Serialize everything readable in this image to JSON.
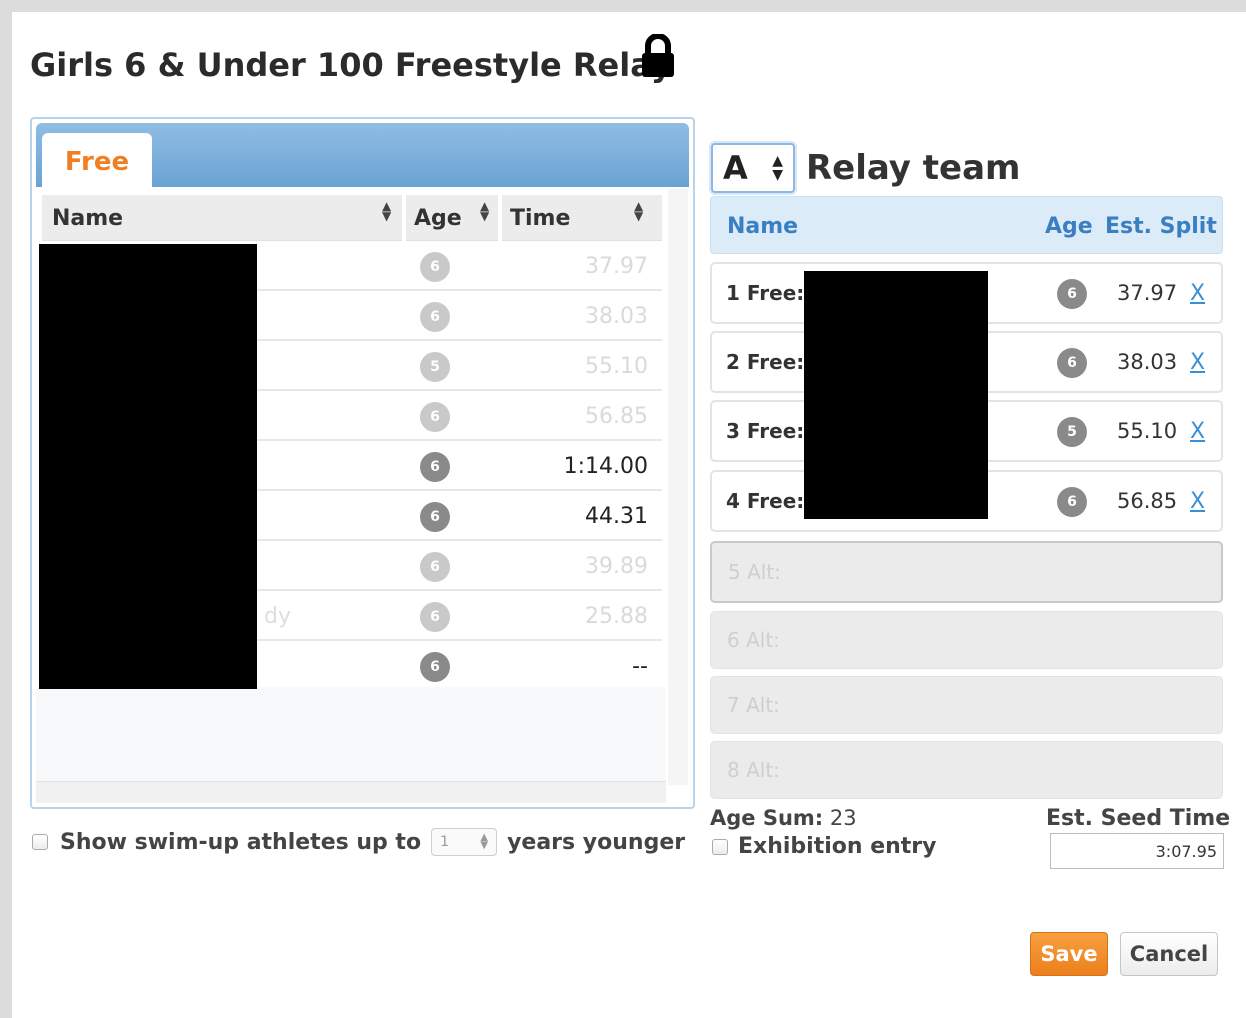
{
  "dialog": {
    "title": "Girls 6 & Under 100 Freestyle Relay",
    "lock_icon": "lock-icon"
  },
  "left": {
    "tab_label": "Free",
    "columns": [
      "Name",
      "Age",
      "Time"
    ],
    "rows": [
      {
        "name_fragment": "",
        "age": "6",
        "time": "37.97",
        "dimmed": true
      },
      {
        "name_fragment": "",
        "age": "6",
        "time": "38.03",
        "dimmed": true
      },
      {
        "name_fragment": "",
        "age": "5",
        "time": "55.10",
        "dimmed": true
      },
      {
        "name_fragment": "",
        "age": "6",
        "time": "56.85",
        "dimmed": true
      },
      {
        "name_fragment": "",
        "age": "6",
        "time": "1:14.00",
        "dimmed": false
      },
      {
        "name_fragment": "",
        "age": "6",
        "time": "44.31",
        "dimmed": false
      },
      {
        "name_fragment": "",
        "age": "6",
        "time": "39.89",
        "dimmed": true
      },
      {
        "name_fragment": "dy",
        "age": "6",
        "time": "25.88",
        "dimmed": true
      },
      {
        "name_fragment": "",
        "age": "6",
        "time": "--",
        "dimmed": false
      }
    ],
    "swimup": {
      "label_before": "Show swim-up athletes up to",
      "value": "1",
      "label_after": "years younger"
    }
  },
  "right": {
    "team_letter": "A",
    "team_label": "Relay team",
    "columns": {
      "name": "Name",
      "age": "Age",
      "split": "Est. Split"
    },
    "slots": [
      {
        "label": "1 Free:",
        "age": "6",
        "split": "37.97",
        "remove": "X"
      },
      {
        "label": "2 Free:",
        "age": "6",
        "split": "38.03",
        "remove": "X"
      },
      {
        "label": "3 Free:",
        "age": "5",
        "split": "55.10",
        "remove": "X"
      },
      {
        "label": "4 Free:",
        "age": "6",
        "split": "56.85",
        "remove": "X"
      }
    ],
    "alternates": [
      "5 Alt:",
      "6 Alt:",
      "7 Alt:",
      "8 Alt:"
    ],
    "age_sum_label": "Age Sum:",
    "age_sum_value": "23",
    "exhibition_label": "Exhibition entry",
    "seed_time_label": "Est. Seed Time",
    "seed_time_value": "3:07.95"
  },
  "buttons": {
    "save": "Save",
    "cancel": "Cancel"
  },
  "colors": {
    "accent_orange": "#ec7f1c",
    "link_blue": "#3a8fd6",
    "header_blue": "#dcebf8"
  }
}
